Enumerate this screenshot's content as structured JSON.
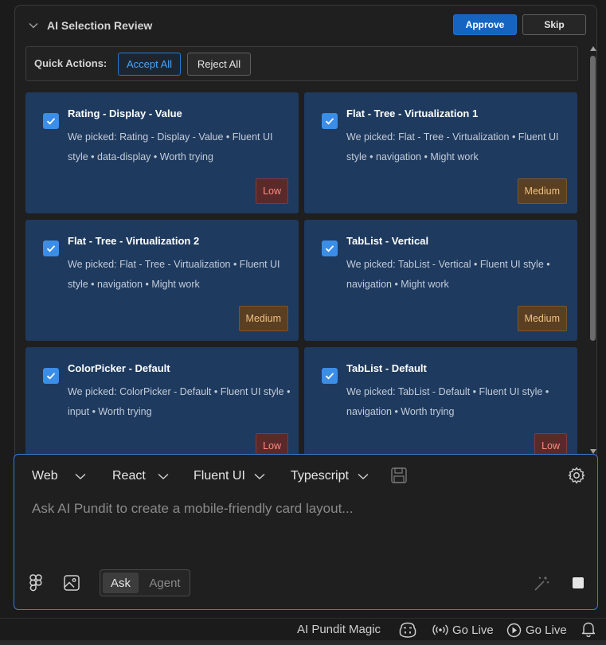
{
  "review": {
    "title": "AI Selection Review",
    "approve_label": "Approve",
    "skip_label": "Skip",
    "quick_actions_label": "Quick Actions:",
    "accept_all_label": "Accept All",
    "reject_all_label": "Reject All",
    "cards": [
      {
        "title": "Rating - Display - Value",
        "description": "We picked: Rating - Display - Value • Fluent UI style • data-display • Worth trying",
        "confidence": "Low",
        "checked": true
      },
      {
        "title": "Flat - Tree - Virtualization 1",
        "description": "We picked: Flat - Tree - Virtualization • Fluent UI style • navigation • Might work",
        "confidence": "Medium",
        "checked": true
      },
      {
        "title": "Flat - Tree - Virtualization 2",
        "description": "We picked: Flat - Tree - Virtualization • Fluent UI style • navigation • Might work",
        "confidence": "Medium",
        "checked": true
      },
      {
        "title": "TabList - Vertical",
        "description": "We picked: TabList - Vertical • Fluent UI style • navigation • Might work",
        "confidence": "Medium",
        "checked": true
      },
      {
        "title": "ColorPicker - Default",
        "description": "We picked: ColorPicker - Default • Fluent UI style • input • Worth trying",
        "confidence": "Low",
        "checked": true
      },
      {
        "title": "TabList - Default",
        "description": "We picked: TabList - Default • Fluent UI style • navigation • Worth trying",
        "confidence": "Low",
        "checked": true
      }
    ]
  },
  "composer": {
    "platform": "Web",
    "framework": "React",
    "design_system": "Fluent UI",
    "language": "Typescript",
    "placeholder": "Ask AI Pundit to create a mobile-friendly card layout...",
    "mode_ask": "Ask",
    "mode_agent": "Agent",
    "active_mode": "Ask"
  },
  "statusbar": {
    "magic_label": "AI Pundit Magic",
    "go_live_1": "Go Live",
    "go_live_2": "Go Live"
  },
  "colors": {
    "accent": "#1565c0",
    "card_bg": "#1e3a5f",
    "low": "#ff8a80",
    "medium": "#f0c080"
  }
}
